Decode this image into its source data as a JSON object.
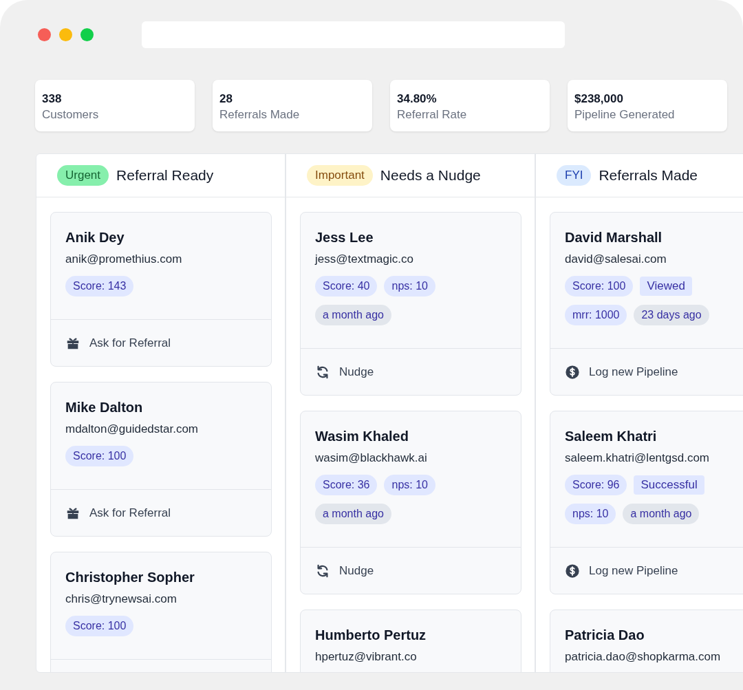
{
  "stats": [
    {
      "value": "338",
      "label": "Customers"
    },
    {
      "value": "28",
      "label": "Referrals Made"
    },
    {
      "value": "34.80%",
      "label": "Referral Rate"
    },
    {
      "value": "$238,000",
      "label": "Pipeline Generated"
    }
  ],
  "columns": [
    {
      "badge": {
        "label": "Urgent",
        "kind": "urgent"
      },
      "title": "Referral Ready",
      "cards": [
        {
          "name": "Anik Dey",
          "email": "anik@promethius.com",
          "tags": [
            {
              "label": "Score: 143",
              "kind": "metric"
            }
          ],
          "action": {
            "label": "Ask for Referral",
            "kind": "referral"
          }
        },
        {
          "name": "Mike Dalton",
          "email": "mdalton@guidedstar.com",
          "tags": [
            {
              "label": "Score: 100",
              "kind": "metric"
            }
          ],
          "action": {
            "label": "Ask for Referral",
            "kind": "referral"
          }
        },
        {
          "name": "Christopher Sopher",
          "email": "chris@trynewsai.com",
          "tags": [
            {
              "label": "Score: 100",
              "kind": "metric"
            }
          ]
        }
      ]
    },
    {
      "badge": {
        "label": "Important",
        "kind": "important"
      },
      "title": "Needs a Nudge",
      "cards": [
        {
          "name": "Jess Lee",
          "email": "jess@textmagic.co",
          "tags": [
            {
              "label": "Score: 40",
              "kind": "metric"
            },
            {
              "label": "nps: 10",
              "kind": "metric"
            },
            {
              "label": "a month ago",
              "kind": "time"
            }
          ],
          "action": {
            "label": "Nudge",
            "kind": "nudge"
          }
        },
        {
          "name": "Wasim Khaled",
          "email": "wasim@blackhawk.ai",
          "tags": [
            {
              "label": "Score: 36",
              "kind": "metric"
            },
            {
              "label": "nps: 10",
              "kind": "metric"
            },
            {
              "label": "a month ago",
              "kind": "time"
            }
          ],
          "action": {
            "label": "Nudge",
            "kind": "nudge"
          }
        },
        {
          "name": "Humberto Pertuz",
          "email": "hpertuz@vibrant.co"
        }
      ]
    },
    {
      "badge": {
        "label": "FYI",
        "kind": "fyi"
      },
      "title": "Referrals Made",
      "cards": [
        {
          "name": "David Marshall",
          "email": "david@salesai.com",
          "tags": [
            {
              "label": "Score: 100",
              "kind": "metric"
            },
            {
              "label": "Viewed",
              "kind": "status"
            },
            {
              "label": "mrr: 1000",
              "kind": "metric"
            },
            {
              "label": "23 days ago",
              "kind": "time"
            }
          ],
          "action": {
            "label": "Log new Pipeline",
            "kind": "pipeline"
          }
        },
        {
          "name": "Saleem Khatri",
          "email": "saleem.khatri@lentgsd.com",
          "tags": [
            {
              "label": "Score: 96",
              "kind": "metric"
            },
            {
              "label": "Successful",
              "kind": "status"
            },
            {
              "label": "nps: 10",
              "kind": "metric"
            },
            {
              "label": "a month ago",
              "kind": "time"
            }
          ],
          "action": {
            "label": "Log new Pipeline",
            "kind": "pipeline"
          }
        },
        {
          "name": "Patricia Dao",
          "email": "patricia.dao@shopkarma.com"
        }
      ]
    }
  ]
}
